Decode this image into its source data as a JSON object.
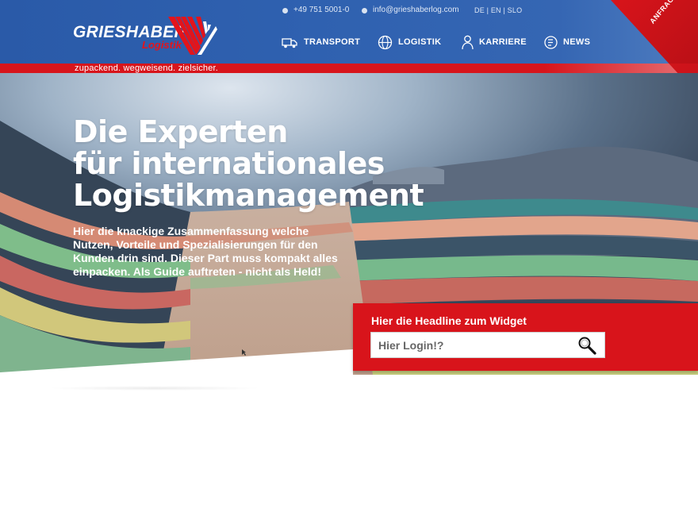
{
  "brand": {
    "name": "GRIESHABER",
    "sub": "Logistik",
    "tagline": "zupackend. wegweisend. zielsicher."
  },
  "contact": {
    "phone": "+49 751 5001-0",
    "email": "info@grieshaberlog.com"
  },
  "languages": "DE | EN | SLO",
  "nav": {
    "items": [
      {
        "label": "TRANSPORT",
        "icon": "truck-icon"
      },
      {
        "label": "LOGISTIK",
        "icon": "globe-icon"
      },
      {
        "label": "KARRIERE",
        "icon": "person-icon"
      },
      {
        "label": "NEWS",
        "icon": "news-icon"
      }
    ]
  },
  "cta": {
    "label": "ANFRAGE"
  },
  "hero": {
    "headline": [
      "Die Experten",
      "für internationales",
      "Logistikmanagement"
    ],
    "lead": "Hier die knackige Zusammenfassung welche Nutzen, Vorteile  und Spezialisierungen für den Kunden drin sind. Dieser Part muss kompakt alles einpacken. Als Guide auftreten - nicht als Held!"
  },
  "widget": {
    "title": "Hier die Headline zum Widget",
    "placeholder": "Hier Login!?"
  },
  "colors": {
    "brand_blue": "#2f61b0",
    "brand_red": "#d8141b",
    "white": "#ffffff"
  }
}
